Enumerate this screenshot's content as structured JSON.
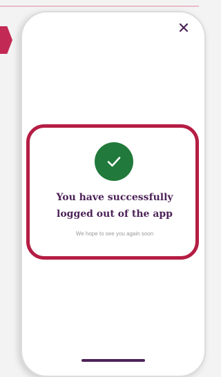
{
  "screen": {
    "icons": {
      "close": "close-icon",
      "success": "check-icon"
    },
    "colors": {
      "highlight_border": "#b51d44",
      "side_marker": "#c22a55",
      "success_green": "#217a3b",
      "headline_purple": "#4c2358",
      "home_indicator": "#4d2358"
    },
    "message": {
      "title": "You have successfully logged out of the app",
      "subtitle": "We hope to see you again soon"
    }
  }
}
